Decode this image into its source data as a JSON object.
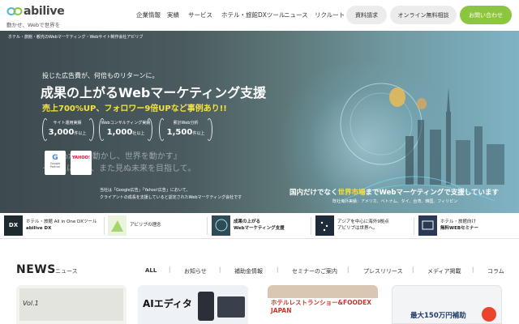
{
  "header": {
    "logo_text": "abilive",
    "tagline": "動かせ、Webで世界を",
    "nav": [
      "企業情報",
      "実績",
      "サービス",
      "ホテル・旅館DXツール",
      "ニュース",
      "リクルート"
    ],
    "buttons": {
      "docs": "資料請求",
      "consult": "オンライン無料相談",
      "contact": "お問い合わせ"
    }
  },
  "hero": {
    "breadcrumb": "ホテル・旅館・観光のWebマーケティング・Webサイト制作会社アビリブ",
    "lead": "投じた広告費が、何倍ものリターンに。",
    "title": "成果の上がるWebマーケティング支援",
    "subtitle": "売上700%UP、フォロワー9倍UPなど事例あり!!",
    "stats": [
      {
        "label": "サイト運用実績",
        "value": "3,000",
        "unit": "件以上"
      },
      {
        "label": "Webコンサルティング実績",
        "value": "1,000",
        "unit": "社以上"
      },
      {
        "label": "累計Web分析",
        "value": "1,500",
        "unit": "件以上"
      }
    ],
    "overlay_lines": [
      "『Webが人を動かし、世界を動かす』",
      "その先にある、また見ぬ未来を目指して。"
    ],
    "ad_badges": [
      "Google Partner",
      "YAHOO!"
    ],
    "ad_note_lines": [
      "当社は「Google広告」「Yahoo!広告」において、",
      "クライアントの成長を支援していると認定されたWebマーケティング会社です"
    ],
    "global_prefix": "国内だけでなく",
    "global_highlight": "世界市場",
    "global_suffix": "までWebマーケティングで支援しています",
    "global_sub": "既社海外実績：アメリカ、ベトナム、タイ、台湾、韓国、フィリピン"
  },
  "features": [
    {
      "line1": "ホテル・旅館 All in One DXツール",
      "line2": "abilive DX"
    },
    {
      "line1": "アビリブの理念",
      "line2": ""
    },
    {
      "line1": "成果の上がる",
      "line2": "Webマーケティング支援"
    },
    {
      "line1": "アジアを中心に海外9拠点",
      "line2": "アビリブは世界へ。"
    },
    {
      "line1": "ホテル・旅館向け",
      "line2": "無料WEBセミナー"
    }
  ],
  "news": {
    "title": "NEWS",
    "subtitle": "ニュース",
    "filters": [
      "ALL",
      "お知らせ",
      "補助金情報",
      "セミナーのご案内",
      "プレスリリース",
      "メディア掲載",
      "コラム"
    ],
    "cards": [
      {
        "caption": "Vol.1"
      },
      {
        "caption": "AIエディタ"
      },
      {
        "caption": "ホテルレストランショー&FOODEX JAPAN"
      },
      {
        "caption": "最大150万円補助"
      }
    ]
  },
  "colors": {
    "accent_green": "#8cc63f",
    "highlight_yellow": "#f4e33a",
    "hero_dark": "#3d4a4f"
  }
}
